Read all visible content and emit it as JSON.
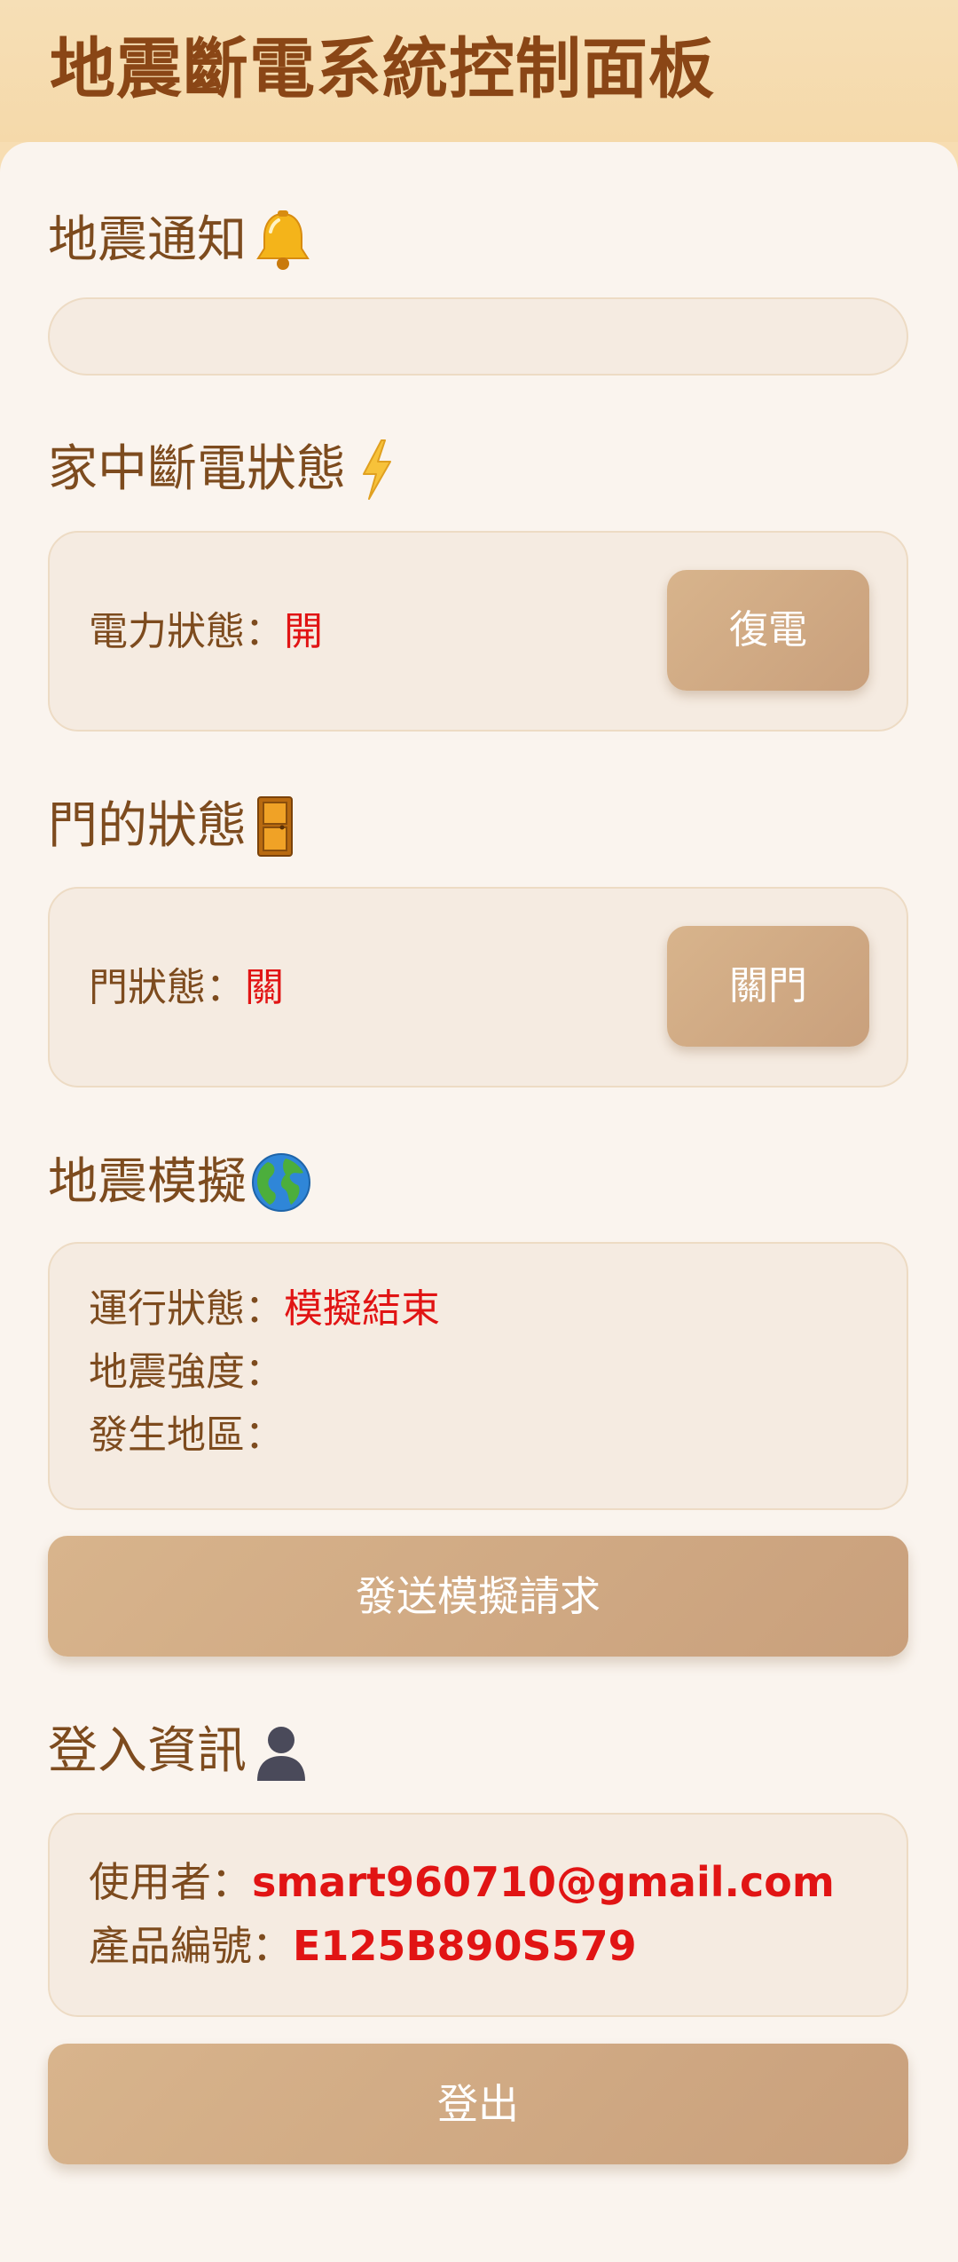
{
  "header": {
    "title": "地震斷電系統控制面板"
  },
  "notification": {
    "title": "地震通知",
    "icon": "bell-icon",
    "message": ""
  },
  "power": {
    "title": "家中斷電狀態",
    "icon": "lightning-icon",
    "status_label": "電力狀態：",
    "status_value": "開",
    "button_label": "復電"
  },
  "door": {
    "title": "門的狀態",
    "icon": "door-icon",
    "status_label": "門狀態：",
    "status_value": "關",
    "button_label": "關門"
  },
  "simulation": {
    "title": "地震模擬",
    "icon": "globe-icon",
    "run_label": "運行狀態：",
    "run_value": "模擬結束",
    "intensity_label": "地震強度：",
    "intensity_value": "",
    "region_label": "發生地區：",
    "region_value": "",
    "send_button_label": "發送模擬請求"
  },
  "login": {
    "title": "登入資訊",
    "icon": "user-silhouette-icon",
    "user_label": "使用者：",
    "user_value": "smart960710@gmail.com",
    "product_label": "產品編號：",
    "product_value": "E125B890S579",
    "logout_button_label": "登出"
  },
  "colors": {
    "accent": "#c9a07c",
    "title_brown": "#8a4616",
    "alert_red": "#e11414",
    "panel_bg": "#faf4ee",
    "header_bg": "#f6dfb6"
  }
}
